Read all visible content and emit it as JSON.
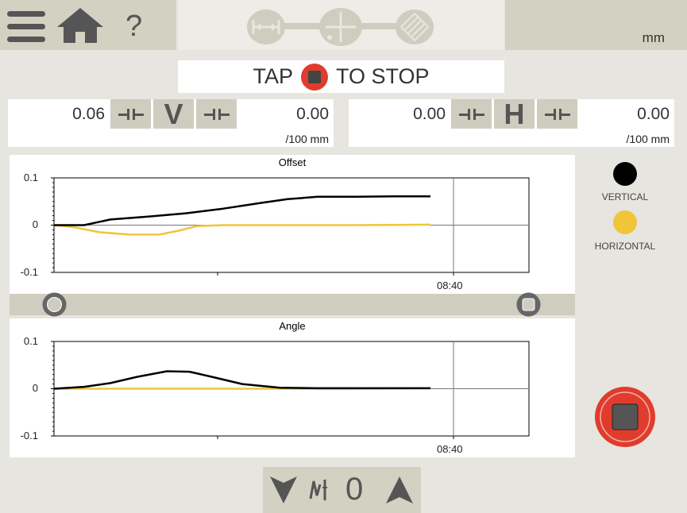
{
  "header": {
    "menu_icon": "hamburger-menu-icon",
    "home_icon": "home-icon",
    "help_label": "?",
    "steps": [
      "distance-step-icon",
      "center-step-icon",
      "measure-step-icon"
    ],
    "units": "mm"
  },
  "banner": {
    "text_before": "TAP",
    "text_after": "TO STOP"
  },
  "vertical": {
    "letter": "V",
    "left_value": "0.06",
    "right_value": "0.00",
    "unit": "/100 mm"
  },
  "horizontal": {
    "letter": "H",
    "left_value": "0.00",
    "right_value": "0.00",
    "unit": "/100 mm"
  },
  "legend": {
    "vertical_label": "VERTICAL",
    "horizontal_label": "HORIZONTAL",
    "vertical_color": "#000000",
    "horizontal_color": "#f0c53a"
  },
  "bottom": {
    "down_icon": "arrow-down-icon",
    "filter_icon": "filter-icon",
    "count": "0",
    "up_icon": "arrow-up-icon"
  },
  "colors": {
    "accent_red": "#e03c2d",
    "bar": "#d3d1c1",
    "background": "#e6e5df"
  },
  "chart_data": [
    {
      "type": "line",
      "title": "Offset",
      "y_ticks": [
        "0.1",
        "0",
        "-0.1"
      ],
      "ylim": [
        -0.1,
        0.1
      ],
      "x_tick_labels": [
        "08:40"
      ],
      "grid": true,
      "series": [
        {
          "color": "#000000",
          "x": [
            0,
            0.08,
            0.15,
            0.25,
            0.35,
            0.45,
            0.55,
            0.62,
            0.7,
            0.8,
            0.9,
            1.0
          ],
          "values": [
            0.0,
            0.0,
            0.012,
            0.018,
            0.025,
            0.035,
            0.047,
            0.055,
            0.06,
            0.06,
            0.061,
            0.061
          ]
        },
        {
          "color": "#f0c53a",
          "x": [
            0,
            0.05,
            0.12,
            0.2,
            0.28,
            0.33,
            0.38,
            0.45,
            0.6,
            0.8,
            1.0
          ],
          "values": [
            0.0,
            -0.004,
            -0.015,
            -0.02,
            -0.02,
            -0.012,
            -0.002,
            0.0,
            0.0,
            0.0,
            0.001
          ]
        }
      ]
    },
    {
      "type": "line",
      "title": "Angle",
      "y_ticks": [
        "0.1",
        "0",
        "-0.1"
      ],
      "ylim": [
        -0.1,
        0.1
      ],
      "x_tick_labels": [
        "08:40"
      ],
      "grid": true,
      "series": [
        {
          "color": "#000000",
          "x": [
            0,
            0.08,
            0.15,
            0.22,
            0.3,
            0.36,
            0.42,
            0.5,
            0.6,
            0.7,
            0.8,
            1.0
          ],
          "values": [
            0.0,
            0.004,
            0.012,
            0.025,
            0.037,
            0.036,
            0.025,
            0.01,
            0.002,
            0.001,
            0.001,
            0.001
          ]
        },
        {
          "color": "#f0c53a",
          "x": [
            0,
            0.2,
            0.4,
            0.6,
            0.8,
            1.0
          ],
          "values": [
            0.0,
            0.0,
            0.0,
            0.0,
            0.0,
            0.001
          ]
        }
      ]
    }
  ]
}
